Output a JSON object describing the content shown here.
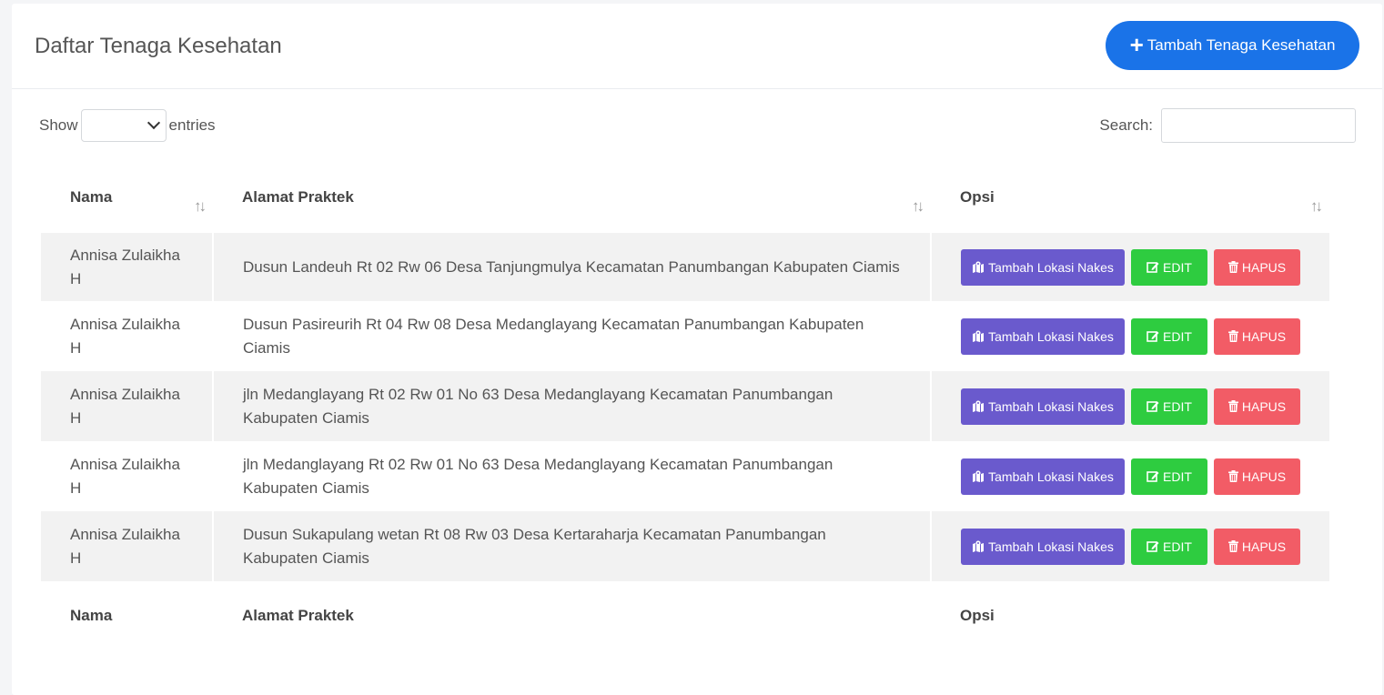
{
  "header": {
    "title": "Daftar Tenaga Kesehatan",
    "add_button_label": "Tambah Tenaga Kesehatan"
  },
  "controls": {
    "show_label": "Show",
    "entries_label": "entries",
    "search_label": "Search:"
  },
  "table": {
    "columns": [
      "Nama",
      "Alamat Praktek",
      "Opsi"
    ],
    "rows": [
      {
        "nama": "Annisa Zulaikha H",
        "alamat": "Dusun Landeuh Rt 02 Rw 06 Desa Tanjungmulya Kecamatan Panumbangan Kabupaten Ciamis"
      },
      {
        "nama": "Annisa Zulaikha H",
        "alamat": "Dusun Pasireurih Rt 04 Rw 08 Desa Medanglayang Kecamatan Panumbangan Kabupaten Ciamis"
      },
      {
        "nama": "Annisa Zulaikha H",
        "alamat": "jln Medanglayang Rt 02 Rw 01 No 63 Desa Medanglayang Kecamatan Panumbangan Kabupaten Ciamis"
      },
      {
        "nama": "Annisa Zulaikha H",
        "alamat": "jln Medanglayang Rt 02 Rw 01 No 63 Desa Medanglayang Kecamatan Panumbangan Kabupaten Ciamis"
      },
      {
        "nama": "Annisa Zulaikha H",
        "alamat": "Dusun Sukapulang wetan Rt 08 Rw 03 Desa Kertaraharja Kecamatan Panumbangan Kabupaten Ciamis"
      }
    ],
    "actions": {
      "lokasi": "Tambah Lokasi Nakes",
      "edit": "EDIT",
      "hapus": "HAPUS"
    }
  },
  "colors": {
    "primary": "#1a73e8",
    "lokasi": "#6a5acd",
    "edit": "#2ecc40",
    "hapus": "#f25c66"
  },
  "icons": {
    "add": "plus-icon",
    "lokasi": "map-marker-icon",
    "edit": "edit-icon",
    "hapus": "trash-icon",
    "sort": "sort-icon"
  }
}
